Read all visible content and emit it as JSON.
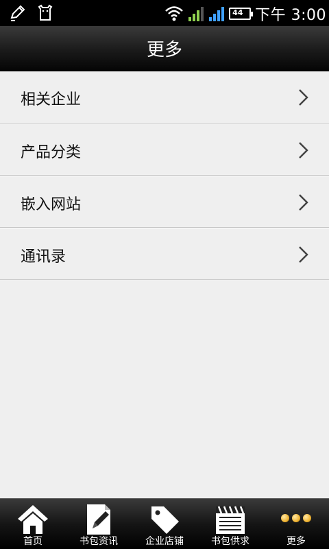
{
  "status": {
    "time": "下午 3:00",
    "battery": "44"
  },
  "header": {
    "title": "更多"
  },
  "list": {
    "items": [
      {
        "label": "相关企业"
      },
      {
        "label": "产品分类"
      },
      {
        "label": "嵌入网站"
      },
      {
        "label": "通讯录"
      }
    ]
  },
  "tabbar": {
    "tabs": [
      {
        "label": "首页",
        "icon": "home-icon"
      },
      {
        "label": "书包资讯",
        "icon": "document-pencil-icon"
      },
      {
        "label": "企业店铺",
        "icon": "tag-icon"
      },
      {
        "label": "书包供求",
        "icon": "clapperboard-icon"
      },
      {
        "label": "更多",
        "icon": "more-dots-icon"
      }
    ]
  },
  "colors": {
    "accent": "#f0b434",
    "header": "#1a1a1a",
    "background": "#efefef"
  }
}
